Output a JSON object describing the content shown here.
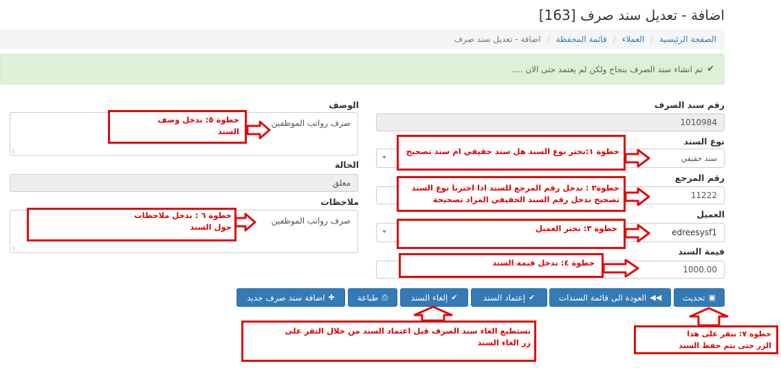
{
  "page": {
    "title": "اضافة - تعديل سند صرف [163]"
  },
  "breadcrumb": {
    "items": [
      "الصفحة الرئيسية",
      "العملاء",
      "قائمة المحفظة"
    ],
    "active": "اضافة - تعديل سند صرف"
  },
  "alert": {
    "text": "تم انشاء سند الصرف بنجاح ولكن لم يعتمد حتى الان ...."
  },
  "form": {
    "voucher_number_label": "رقم سند الصرف",
    "voucher_number_value": "1010984",
    "voucher_type_label": "نوع السند",
    "voucher_type_value": "سند حقيقي",
    "reference_label": "رقم المرجع",
    "reference_value": "11222",
    "client_label": "العميل",
    "client_value": "edreesysf1",
    "amount_label": "قيمة السند",
    "amount_value": "1000.00",
    "description_label": "الوصف",
    "description_value": "صرف رواتب الموظفين",
    "status_label": "الحالة",
    "status_value": "معلق",
    "notes_label": "ملاحظات",
    "notes_value": "صرف رواتب الموظفين"
  },
  "buttons": {
    "update": "تحديث",
    "back": "العودة الى قائمة السندات",
    "approve": "إعتماد السند",
    "cancel": "إلغاء السند",
    "print": "طباعة",
    "add_new": "اضافة سند صرف جديد"
  },
  "annotations": {
    "step1": "خطوة ١:نختر نوع السند هل سند حقيقي ام سند تصحيح",
    "step2_line1": "خطوة٢ : ندخل رقم المرجع للسند اذا اخترنا نوع السند",
    "step2_line2": "تصحيح ندخل رقم السند الحقيقي المراد تصحيحة",
    "step3": "خطوة ٣: نختر العميل",
    "step4": "خطوة ٤: ندخل قيمة السند",
    "step5_line1": "خطوة ٥: ندخل وصف",
    "step5_line2": "السند",
    "step6_line1": "خطوة ٦ : ندخل ملاحظات",
    "step6_line2": "حول السند",
    "step7_line1": "خطوة ٧: ننقر على هذا",
    "step7_line2": "الزر حتى يتم حفظ السند",
    "cancel_note_line1": "نستطيع الغاء سند الصرف قبل اعتماد السند من خلال النقر على",
    "cancel_note_line2": "زر الغاء السند"
  },
  "colors": {
    "primary": "#337ab7",
    "annotation_red": "#e10a0a",
    "success_bg": "#dff0d8",
    "success_text": "#3c763d"
  }
}
